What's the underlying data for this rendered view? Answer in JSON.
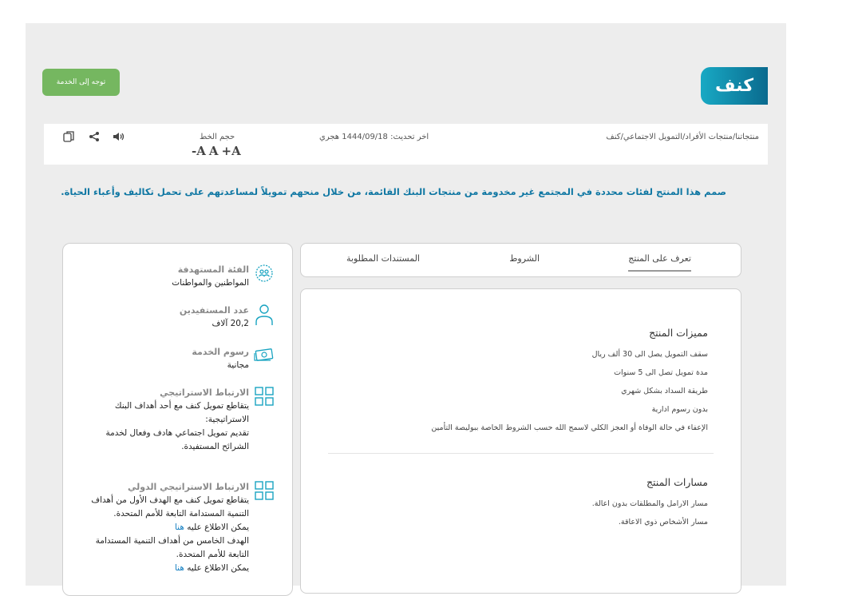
{
  "page": {
    "title": "كنف",
    "service_button": "توجه إلى الخدمة",
    "tagline": "صمم هذا المنتج لفئات محددة في المجتمع غير مخدومة من منتجات البنك القائمة، من خلال منحهم تمويلاً لمساعدتهم على تحمل تكاليف وأعباء الحياة."
  },
  "breadcrumb": [
    "منتجاتنا",
    "منتجات الأفراد",
    "التمويل الاجتماعي",
    "كنف"
  ],
  "breadcrumb_sep": "/",
  "updated": "اخر تحديث: 1444/09/18 هجري",
  "font_size": {
    "label": "حجم الخط",
    "decrease": "-A",
    "normal": "A",
    "increase": "+A"
  },
  "tools": {
    "copy_icon": "copy-icon",
    "share_icon": "share-icon",
    "audio_icon": "speaker-icon"
  },
  "colors": {
    "brand": "#0f77a3",
    "badge_start": "#18a9c4",
    "badge_end": "#0a6a8e",
    "button": "#75b760",
    "icon": "#19a4c1",
    "link": "#1780c2"
  },
  "features": {
    "target": {
      "title": "الفئة المستهدفة",
      "value": "المواطنين والمواطنات",
      "icon": "group-icon"
    },
    "beneficiaries": {
      "title": "عدد المستفيدين",
      "value": "20,2 آلاف",
      "icon": "person-icon"
    },
    "fees": {
      "title": "رسوم الخدمة",
      "value": "مجانية",
      "icon": "money-icon"
    },
    "strategic": {
      "title": "الارتباط الاستراتيجي",
      "line1": "يتقاطع تمويل كنف مع أحد أهداف البنك",
      "line2": "الاستراتيجية:",
      "line3": "تقديم تمويل اجتماعي هادف وفعال لخدمة",
      "line4": "الشرائح المستفيدة.",
      "icon": "grid-icon"
    },
    "international": {
      "title": "الارتباط الاستراتيجي الدولي",
      "line1": "يتقاطع تمويل كنف مع الهدف الأول من أهداف",
      "line2": "التنمية المستدامة التابعة للأمم المتحدة.",
      "line3": "يمكن الاطلاع عليه",
      "link1": "هنا",
      "line4": "الهدف الخامس من أهداف التنمية المستدامة",
      "line5": "التابعة للأمم المتحدة.",
      "line6": "يمكن الاطلاع عليه",
      "link2": "هنا",
      "icon": "grid-icon"
    }
  },
  "tabs": [
    {
      "label": "تعرف على المنتج",
      "active": true
    },
    {
      "label": "الشروط",
      "active": false
    },
    {
      "label": "المستندات المطلوبة",
      "active": false
    }
  ],
  "product": {
    "features_title": "مميزات المنتج",
    "features": [
      "سقف التمويل يصل الى 30 ألف ريال",
      "مدة تمويل تصل الى 5 سنوات",
      "طريقة السداد بشكل شهري",
      "بدون رسوم ادارية",
      "الإعفاء في حالة الوفاة أو العجز الكلي لاسمح الله حسب الشروط الخاصة ببوليصة التأمين"
    ],
    "tracks_title": "مسارات المنتج",
    "tracks": [
      "مسار الارامل والمطلقات بدون اعالة.",
      "مسار الأشخاص ذوي الاعاقة."
    ]
  }
}
